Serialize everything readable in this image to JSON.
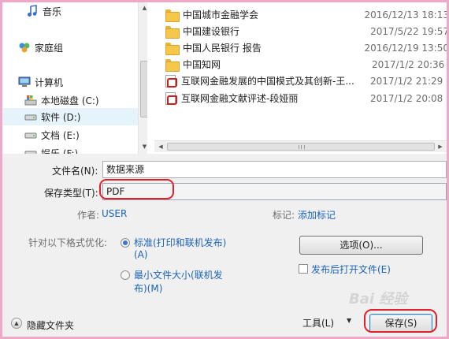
{
  "nav": {
    "items": [
      {
        "label": "音乐",
        "icon": "music-icon"
      },
      {
        "label": "家庭组",
        "icon": "homegroup-icon"
      },
      {
        "label": "计算机",
        "icon": "computer-icon"
      },
      {
        "label": "本地磁盘 (C:)",
        "icon": "drive-icon"
      },
      {
        "label": "软件 (D:)",
        "icon": "drive-icon"
      },
      {
        "label": "文档 (E:)",
        "icon": "drive-icon"
      },
      {
        "label": "娱乐 (F:)",
        "icon": "drive-icon"
      }
    ]
  },
  "files": [
    {
      "name": "中国城市金融学会",
      "date": "2016/12/13 18:13",
      "type": "folder"
    },
    {
      "name": "中国建设银行",
      "date": "2017/5/22 19:57",
      "type": "folder"
    },
    {
      "name": "中国人民银行 报告",
      "date": "2016/12/19 13:50",
      "type": "folder"
    },
    {
      "name": "中国知网",
      "date": "2017/1/2 20:36",
      "type": "folder"
    },
    {
      "name": "互联网金融发展的中国模式及其创新-王...",
      "date": "2017/1/2 21:29",
      "type": "pdf"
    },
    {
      "name": "互联网金融文献评述-段娅丽",
      "date": "2017/1/2 20:08",
      "type": "pdf"
    }
  ],
  "form": {
    "filename_label": "文件名(N):",
    "filename_value": "数据来源",
    "savetype_label": "保存类型(T):",
    "savetype_value": "PDF",
    "author_label": "作者:",
    "author_value": "USER",
    "tags_label": "标记:",
    "tags_value": "添加标记",
    "optimize_label": "针对以下格式优化:",
    "opt_standard_line1": "标准(打印和联机发布)",
    "opt_standard_line2": "(A)",
    "opt_minimum_line1": "最小文件大小(联机发",
    "opt_minimum_line2": "布)(M)",
    "options_button": "选项(O)...",
    "open_after_label": "发布后打开文件(E)"
  },
  "footer": {
    "hide_folders": "隐藏文件夹",
    "tools": "工具(L)",
    "save": "保存(S)"
  },
  "watermark": "Bai 经验"
}
